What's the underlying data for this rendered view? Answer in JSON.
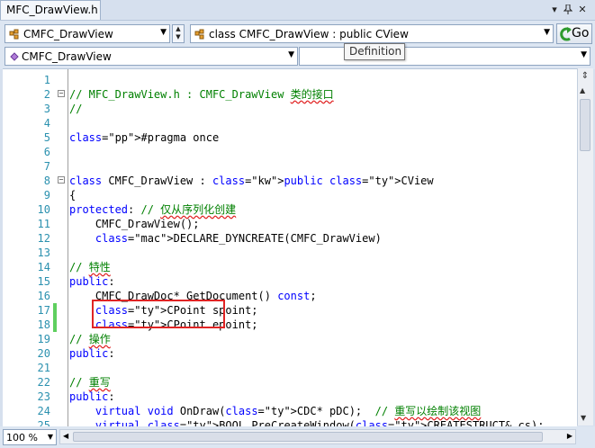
{
  "window": {
    "tab_title": "MFC_DrawView.h",
    "ctrl_dropdown": "▾",
    "ctrl_pin": "📌",
    "ctrl_close": "✕"
  },
  "nav": {
    "class_combo": "CMFC_DrawView",
    "member_combo": "class CMFC_DrawView : public CView",
    "scope_combo": "CMFC_DrawView",
    "scope_right_combo": "",
    "go_label": "Go",
    "tooltip": "Definition"
  },
  "code_lines": [
    {
      "n": "1",
      "t": ""
    },
    {
      "n": "2",
      "t": "// MFC_DrawView.h : CMFC_DrawView 类的接口"
    },
    {
      "n": "3",
      "t": "//"
    },
    {
      "n": "4",
      "t": ""
    },
    {
      "n": "5",
      "t": "#pragma once"
    },
    {
      "n": "6",
      "t": ""
    },
    {
      "n": "7",
      "t": ""
    },
    {
      "n": "8",
      "t": "class CMFC_DrawView : public CView"
    },
    {
      "n": "9",
      "t": "{"
    },
    {
      "n": "10",
      "t": "protected: // 仅从序列化创建"
    },
    {
      "n": "11",
      "t": "    CMFC_DrawView();"
    },
    {
      "n": "12",
      "t": "    DECLARE_DYNCREATE(CMFC_DrawView)"
    },
    {
      "n": "13",
      "t": ""
    },
    {
      "n": "14",
      "t": "// 特性"
    },
    {
      "n": "15",
      "t": "public:"
    },
    {
      "n": "16",
      "t": "    CMFC_DrawDoc* GetDocument() const;"
    },
    {
      "n": "17",
      "t": "    CPoint spoint;"
    },
    {
      "n": "18",
      "t": "    CPoint epoint;"
    },
    {
      "n": "19",
      "t": "// 操作"
    },
    {
      "n": "20",
      "t": "public:"
    },
    {
      "n": "21",
      "t": ""
    },
    {
      "n": "22",
      "t": "// 重写"
    },
    {
      "n": "23",
      "t": "public:"
    },
    {
      "n": "24",
      "t": "    virtual void OnDraw(CDC* pDC);  // 重写以绘制该视图"
    },
    {
      "n": "25",
      "t": "    virtual BOOL PreCreateWindow(CREATESTRUCT& cs);"
    }
  ],
  "status": {
    "zoom": "100 %"
  },
  "colors": {
    "line_number": "#2b91af",
    "keyword": "#0000ff",
    "comment": "#008000",
    "macro": "#6f008a",
    "highlight_box": "#e02424",
    "change_bar": "#5fcf5f"
  }
}
